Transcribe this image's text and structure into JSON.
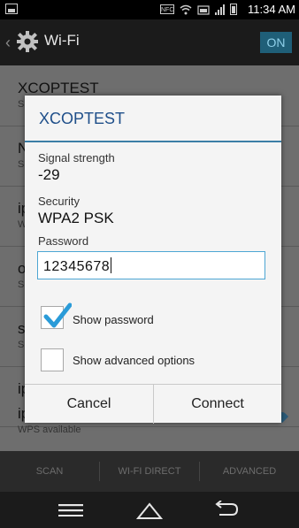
{
  "status_bar": {
    "time": "11:34 AM",
    "nfc_label": "NFC"
  },
  "action_bar": {
    "title": "Wi-Fi",
    "toggle_label": "ON",
    "accent": "#1f5f78"
  },
  "list": [
    {
      "name": "XCOPTEST",
      "sub": "S"
    },
    {
      "name": "N",
      "sub": "S"
    },
    {
      "name": "ip",
      "sub": "W"
    },
    {
      "name": "o",
      "sub": "S"
    },
    {
      "name": "s",
      "sub": "S"
    },
    {
      "name": "ip",
      "sub": ""
    },
    {
      "name": "ip",
      "sub": "WPS available"
    }
  ],
  "dialog": {
    "title": "XCOPTEST",
    "signal_label": "Signal strength",
    "signal_value": "-29",
    "security_label": "Security",
    "security_value": "WPA2 PSK",
    "password_label": "Password",
    "password_value": "12345678",
    "show_password": {
      "label": "Show password",
      "checked": true
    },
    "show_advanced": {
      "label": "Show advanced options",
      "checked": false
    },
    "cancel_label": "Cancel",
    "connect_label": "Connect",
    "title_color": "#1f4f8a",
    "check_color": "#2a9bd8"
  },
  "bottom_strip": {
    "scan": "SCAN",
    "wifi_direct": "WI-FI DIRECT",
    "advanced": "ADVANCED"
  },
  "nav": {
    "icons": [
      "menu-icon",
      "home-icon",
      "back-icon"
    ]
  }
}
